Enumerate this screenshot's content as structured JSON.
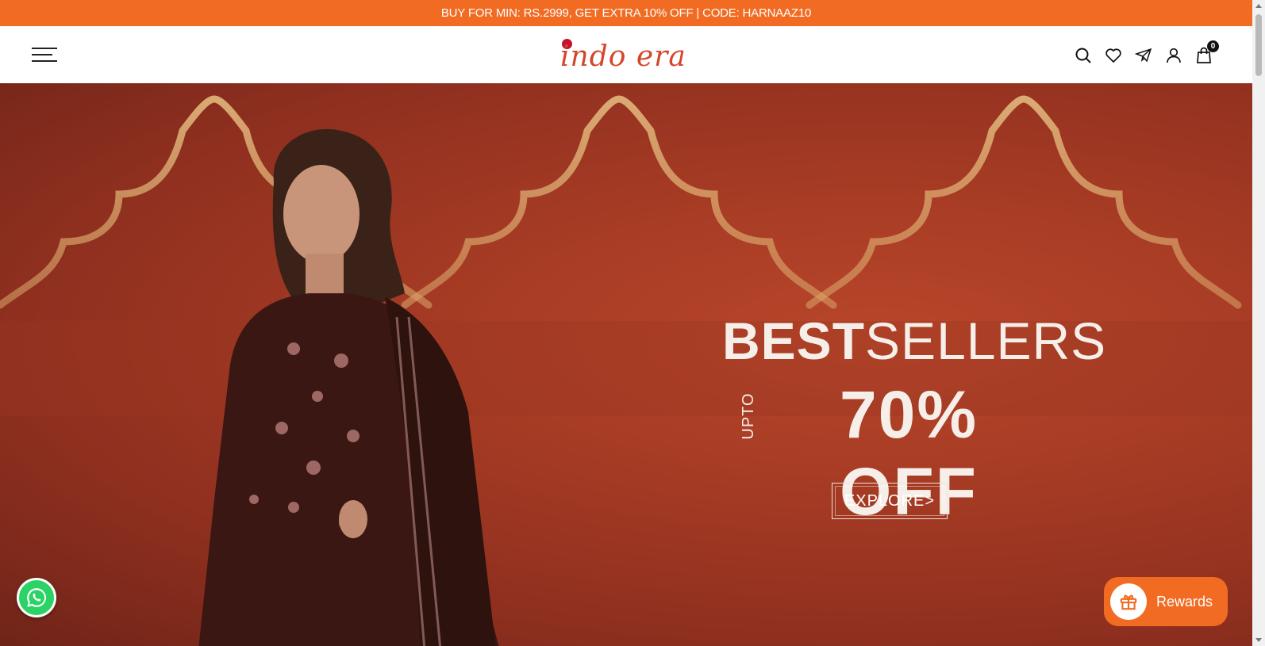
{
  "announcement": "BUY FOR MIN: RS.2999, GET EXTRA 10% OFF | CODE: HARNAAZ10",
  "header": {
    "logo_text": "indo era",
    "cart_count": "0",
    "icons": [
      "menu-icon",
      "search-icon",
      "heart-icon",
      "paper-plane-icon",
      "user-icon",
      "shopping-bag-icon"
    ]
  },
  "hero": {
    "title_bold": "BEST",
    "title_light": "SELLERS",
    "upto": "UPTO",
    "discount": "70% OFF",
    "cta": "EXPLORE>"
  },
  "rewards": {
    "label": "Rewards"
  },
  "colors": {
    "accent": "#f26b22",
    "logo": "#d6452a",
    "hero_bg": "#a63b24",
    "whatsapp": "#2bd366"
  }
}
